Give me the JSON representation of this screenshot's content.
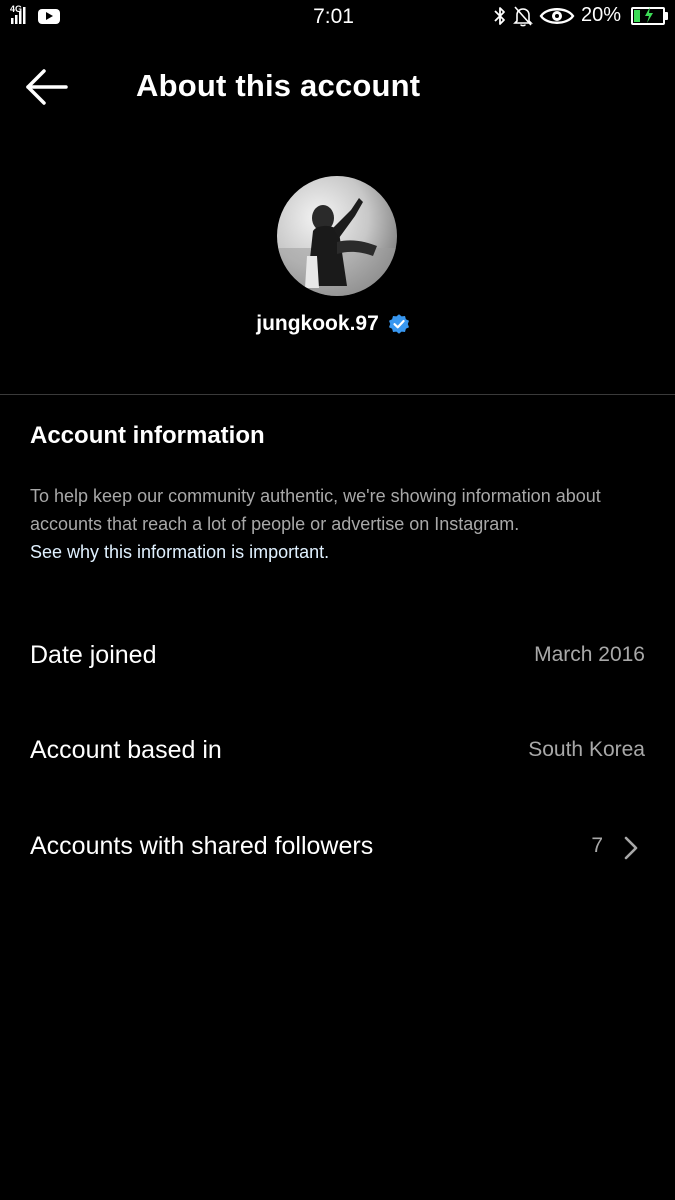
{
  "status_bar": {
    "network": "4G",
    "time": "7:01",
    "battery_percent": "20%",
    "icons": [
      "signal-icon",
      "youtube-icon",
      "bluetooth-icon",
      "muted-bell-icon",
      "eye-icon",
      "battery-charging-icon"
    ],
    "battery_color": "#3ddc57"
  },
  "header": {
    "title": "About this account",
    "back_icon": "back-arrow-icon"
  },
  "profile": {
    "username": "jungkook.97",
    "verified_icon": "verified-badge-icon",
    "verified_color": "#3897f0"
  },
  "account_info": {
    "title": "Account information",
    "description": "To help keep our community authentic, we're showing information about accounts that reach a lot of people or advertise on Instagram.",
    "link": "See why this information is important."
  },
  "rows": {
    "date_joined": {
      "label": "Date joined",
      "value": "March 2016"
    },
    "account_based_in": {
      "label": "Account based in",
      "value": "South Korea"
    },
    "shared_followers": {
      "label": "Accounts with shared followers",
      "value": "7",
      "icon": "chevron-right-icon"
    }
  }
}
